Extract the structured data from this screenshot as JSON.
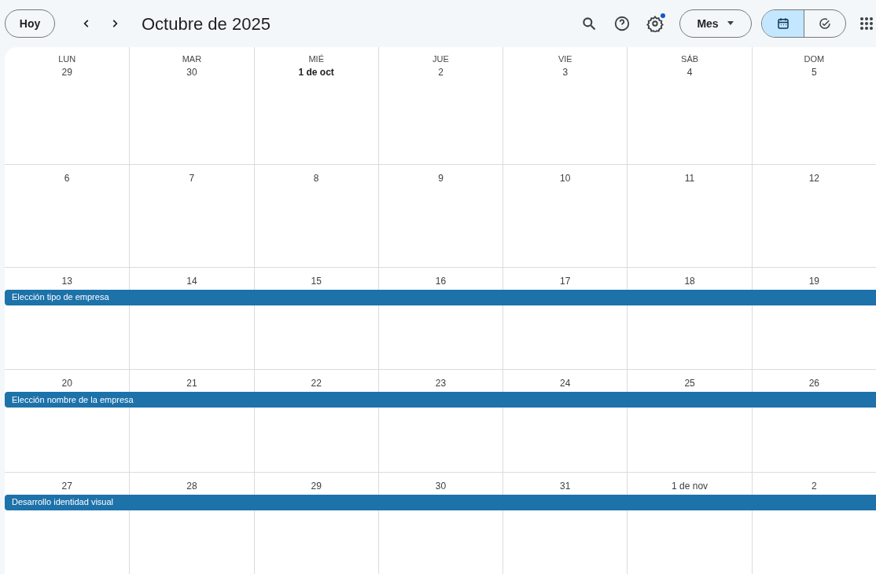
{
  "toolbar": {
    "today_button": "Hoy",
    "title": "Octubre de 2025",
    "settings_badge": true,
    "view_menu": "Mes",
    "view_toggle": [
      {
        "kind": "calendar",
        "selected": true
      },
      {
        "kind": "tasks",
        "selected": false
      }
    ]
  },
  "weekdays": [
    "LUN",
    "MAR",
    "MIÉ",
    "JUE",
    "VIE",
    "SÁB",
    "DOM"
  ],
  "weeks": [
    {
      "days": [
        {
          "label": "29",
          "bold": false
        },
        {
          "label": "30",
          "bold": false
        },
        {
          "label": "1 de oct",
          "bold": true
        },
        {
          "label": "2",
          "bold": false
        },
        {
          "label": "3",
          "bold": false
        },
        {
          "label": "4",
          "bold": false
        },
        {
          "label": "5",
          "bold": false
        }
      ]
    },
    {
      "days": [
        {
          "label": "6",
          "bold": false
        },
        {
          "label": "7",
          "bold": false
        },
        {
          "label": "8",
          "bold": false
        },
        {
          "label": "9",
          "bold": false
        },
        {
          "label": "10",
          "bold": false
        },
        {
          "label": "11",
          "bold": false
        },
        {
          "label": "12",
          "bold": false
        }
      ]
    },
    {
      "days": [
        {
          "label": "13",
          "bold": false
        },
        {
          "label": "14",
          "bold": false
        },
        {
          "label": "15",
          "bold": false
        },
        {
          "label": "16",
          "bold": false
        },
        {
          "label": "17",
          "bold": false
        },
        {
          "label": "18",
          "bold": false
        },
        {
          "label": "19",
          "bold": false
        }
      ],
      "event": {
        "title": "Elección tipo de empresa",
        "color": "#1d72aa"
      }
    },
    {
      "days": [
        {
          "label": "20",
          "bold": false
        },
        {
          "label": "21",
          "bold": false
        },
        {
          "label": "22",
          "bold": false
        },
        {
          "label": "23",
          "bold": false
        },
        {
          "label": "24",
          "bold": false
        },
        {
          "label": "25",
          "bold": false
        },
        {
          "label": "26",
          "bold": false
        }
      ],
      "event": {
        "title": "Elección nombre de la empresa",
        "color": "#1d72aa"
      }
    },
    {
      "days": [
        {
          "label": "27",
          "bold": false
        },
        {
          "label": "28",
          "bold": false
        },
        {
          "label": "29",
          "bold": false
        },
        {
          "label": "30",
          "bold": false
        },
        {
          "label": "31",
          "bold": false
        },
        {
          "label": "1 de nov",
          "bold": false
        },
        {
          "label": "2",
          "bold": false
        }
      ],
      "event": {
        "title": "Desarrollo identidad visual",
        "color": "#1d72aa"
      }
    }
  ]
}
